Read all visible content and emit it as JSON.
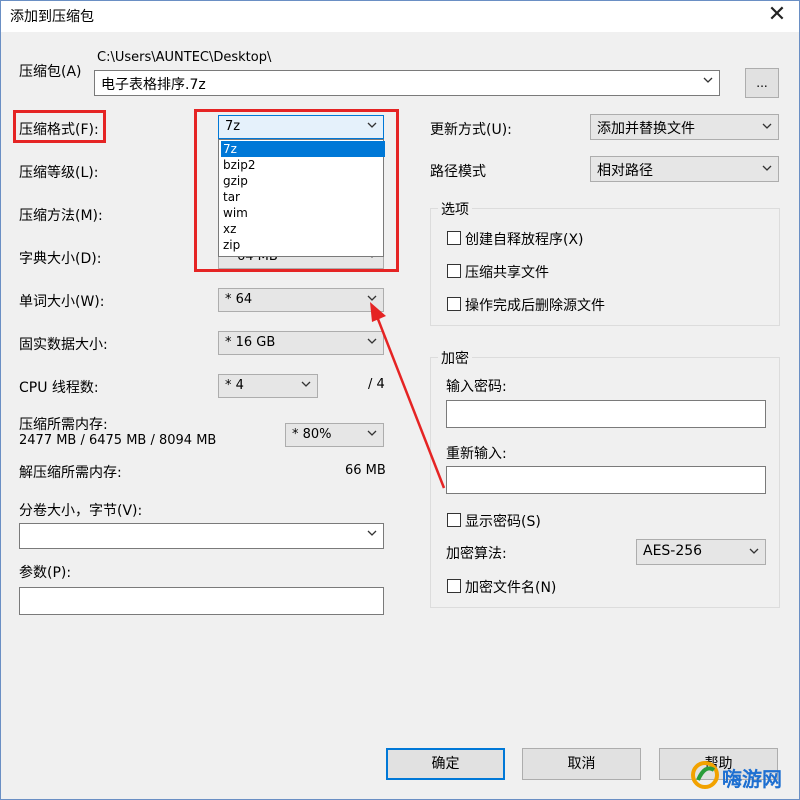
{
  "window": {
    "title": "添加到压缩包",
    "close_glyph": "✕"
  },
  "archive": {
    "label": "压缩包(A)",
    "path": "C:\\Users\\AUNTEC\\Desktop\\",
    "filename": "电子表格排序.7z",
    "browse_label": "..."
  },
  "left": {
    "format_label": "压缩格式(F):",
    "format_value": "7z",
    "format_options": [
      "7z",
      "bzip2",
      "gzip",
      "tar",
      "wim",
      "xz",
      "zip"
    ],
    "format_selected_index": 0,
    "level_label": "压缩等级(L):",
    "method_label": "压缩方法(M):",
    "dict_label": "字典大小(D):",
    "dict_value_partial": "64 MB",
    "word_label": "单词大小(W):",
    "word_value": "* 64",
    "solid_label": "固实数据大小:",
    "solid_value": "* 16 GB",
    "cpu_label": "CPU 线程数:",
    "cpu_value": "* 4",
    "cpu_total": "/ 4",
    "mem_label": "压缩所需内存:",
    "mem_detail": "2477 MB / 6475 MB / 8094 MB",
    "mem_percent": "* 80%",
    "decomp_label": "解压缩所需内存:",
    "decomp_value": "66 MB",
    "split_label": "分卷大小，字节(V):",
    "split_value": "",
    "params_label": "参数(P):",
    "params_value": ""
  },
  "right": {
    "update_label": "更新方式(U):",
    "update_value": "添加并替换文件",
    "path_label": "路径模式",
    "path_value": "相对路径",
    "options_title": "选项",
    "opt_sfx": "创建自释放程序(X)",
    "opt_shared": "压缩共享文件",
    "opt_delete": "操作完成后删除源文件",
    "enc_title": "加密",
    "pwd_label": "输入密码:",
    "pwd_value": "",
    "pwd2_label": "重新输入:",
    "pwd2_value": "",
    "show_pwd": "显示密码(S)",
    "algo_label": "加密算法:",
    "algo_value": "AES-256",
    "enc_names": "加密文件名(N)"
  },
  "buttons": {
    "ok": "确定",
    "cancel": "取消",
    "help": "帮助"
  },
  "watermark": {
    "text": "嗨游网"
  },
  "colors": {
    "accent": "#0078d7",
    "highlight_red": "#e52424",
    "dialog_bg": "#f0f0f0"
  }
}
